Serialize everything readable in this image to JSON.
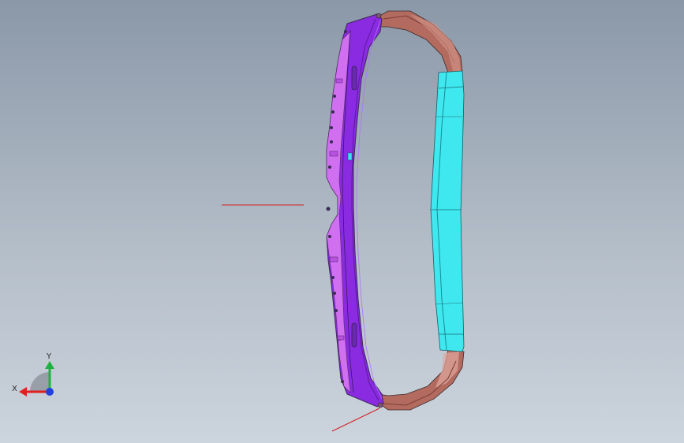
{
  "viewport": {
    "background_top": "#8b98a8",
    "background_bottom": "#ccd4dd"
  },
  "model": {
    "colors": {
      "frame_purple": "#8a2be2",
      "frame_magenta": "#d070f0",
      "panel_cyan": "#3fe8ee",
      "corner_brown": "#b06c60",
      "edge_dark": "#3a2a55",
      "leader_red": "#d02020"
    }
  },
  "triad": {
    "x_label": "X",
    "y_label": "Y",
    "x_color": "#e02020",
    "y_color": "#20b040",
    "z_color": "#2040e0"
  }
}
